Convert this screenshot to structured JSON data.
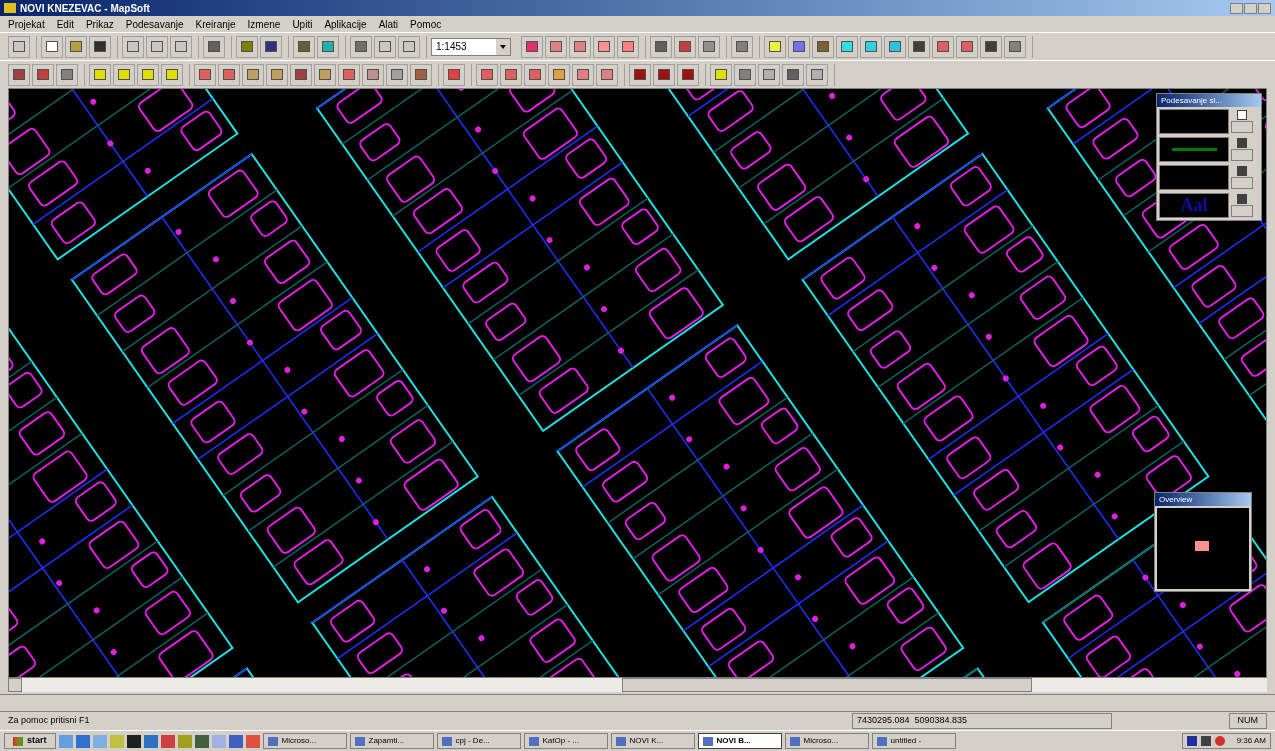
{
  "window": {
    "title": "NOVI KNEZEVAC - MapSoft"
  },
  "menu": [
    "Projekat",
    "Edit",
    "Prikaz",
    "Podesavanje",
    "Kreiranje",
    "Izmene",
    "Upiti",
    "Aplikacije",
    "Alati",
    "Pomoc"
  ],
  "toolbar": {
    "scale": "1:1453"
  },
  "layer_panel": {
    "title": "Podesavanje sl...",
    "layers": [
      {
        "kind": "fill",
        "checked": false
      },
      {
        "kind": "line",
        "checked": true
      },
      {
        "kind": "fill",
        "checked": true
      },
      {
        "kind": "text",
        "checked": true,
        "sample": "Aal"
      }
    ]
  },
  "overview": {
    "title": "Overview"
  },
  "status_bar": {
    "hint": "Za pomoc pritisni F1",
    "coordinates": "7430295.084  5090384.835",
    "indicator": "NUM"
  },
  "taskbar": {
    "start": "start",
    "buttons": [
      {
        "label": "Microso...",
        "selected": false
      },
      {
        "label": "Zapamti...",
        "selected": false
      },
      {
        "label": "cpj - De...",
        "selected": false
      },
      {
        "label": "KatOp - ...",
        "selected": false
      },
      {
        "label": "NOVI K...",
        "selected": false
      },
      {
        "label": "NOVI B...",
        "selected": true
      },
      {
        "label": "Microso...",
        "selected": false
      },
      {
        "label": "untitled -",
        "selected": false
      }
    ],
    "clock": "9:36 AM"
  }
}
